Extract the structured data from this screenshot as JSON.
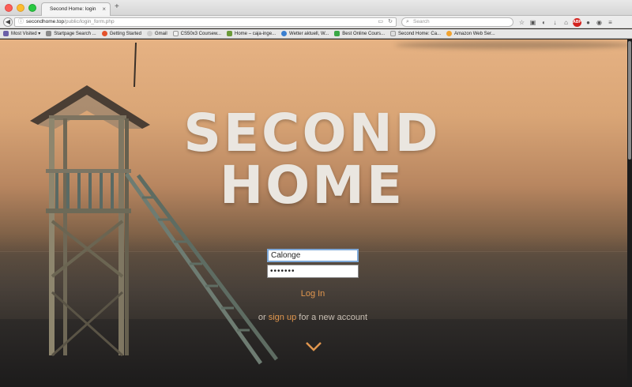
{
  "browser": {
    "tab_title": "Second Home: login",
    "tab_close": "×",
    "new_tab": "+",
    "url_host": "secondhome.top",
    "url_path": "/public/login_form.php",
    "search_placeholder": "Search"
  },
  "bookmarks": [
    {
      "label": "Most Visited ▾",
      "color": "#6b5fa8"
    },
    {
      "label": "Startpage Search ...",
      "color": "#8a8a8a"
    },
    {
      "label": "Getting Started",
      "color": "#e4522b"
    },
    {
      "label": "Gmail",
      "color": "#cccccc"
    },
    {
      "label": "CS50x3 Coursew...",
      "color": "#eeeeee"
    },
    {
      "label": "Home – caja-inge...",
      "color": "#6b9a3a"
    },
    {
      "label": "Wetter aktuell, W...",
      "color": "#3a7fd0"
    },
    {
      "label": "Best Online Cours...",
      "color": "#39a845"
    },
    {
      "label": "Second Home: Ca...",
      "color": "#dddddd"
    },
    {
      "label": "Amazon Web Ser...",
      "color": "#f2a330"
    }
  ],
  "site": {
    "logo_line1": "SECOND",
    "logo_line2": "HOME"
  },
  "login": {
    "username_value": "Calonge",
    "password_value": "•••••••",
    "login_label": "Log In",
    "signup_prefix": "or ",
    "signup_link": "sign up",
    "signup_suffix": " for a new account"
  },
  "colors": {
    "accent": "#e0964e",
    "logo": "#eae6e0"
  }
}
